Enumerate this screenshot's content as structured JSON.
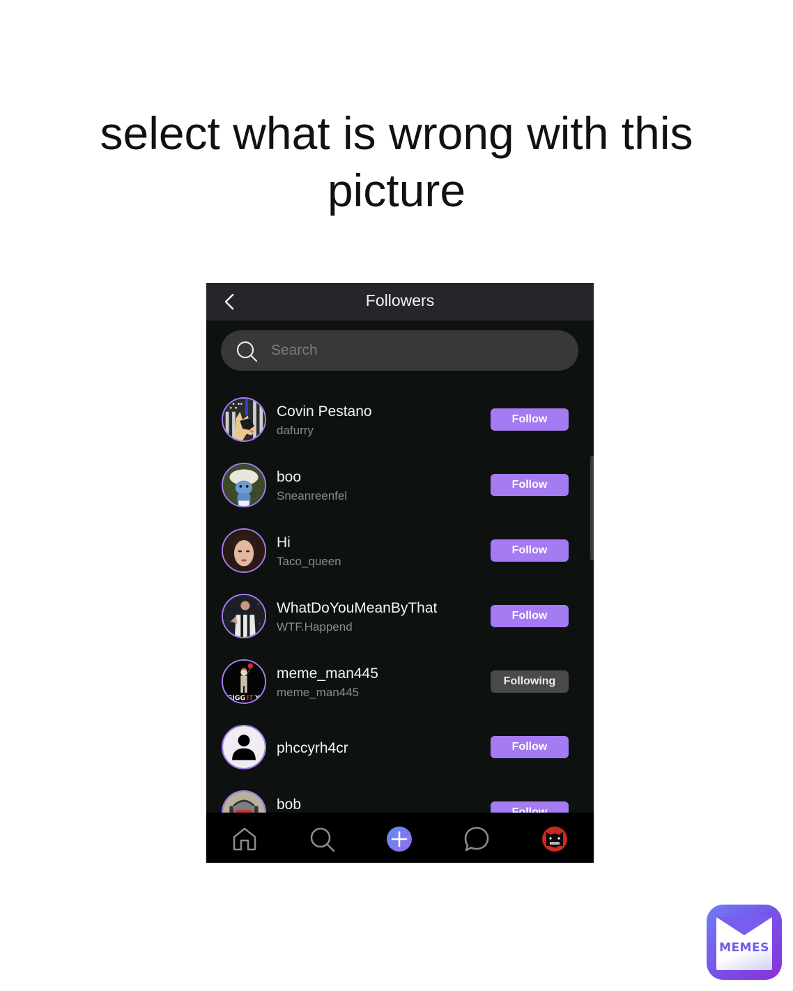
{
  "caption": "select what is wrong with this picture",
  "app": {
    "header": {
      "title": "Followers",
      "back_icon": "chevron-left-icon"
    },
    "search": {
      "placeholder": "Search",
      "value": "",
      "icon": "search-icon"
    },
    "followers": [
      {
        "name": "Covin Pestano",
        "handle": "dafurry",
        "button": "Follow",
        "following": false,
        "avatar": "german-shepherd-flag-avatar"
      },
      {
        "name": "boo",
        "handle": "Sneanreenfel",
        "button": "Follow",
        "following": false,
        "avatar": "smurf-cat-avatar"
      },
      {
        "name": "Hi",
        "handle": "Taco_queen",
        "button": "Follow",
        "following": false,
        "avatar": "woman-portrait-avatar"
      },
      {
        "name": "WhatDoYouMeanByThat",
        "handle": "WTF.Happend",
        "button": "Follow",
        "following": false,
        "avatar": "soccer-player-avatar"
      },
      {
        "name": "meme_man445",
        "handle": "meme_man445",
        "button": "Following",
        "following": true,
        "avatar": "giggity-clown-avatar"
      },
      {
        "name": "phccyrh4cr",
        "handle": "",
        "button": "Follow",
        "following": false,
        "avatar": "default-person-avatar"
      },
      {
        "name": "bob",
        "handle": "",
        "button": "Follow",
        "following": false,
        "avatar": "masked-soldier-avatar"
      }
    ],
    "tabbar": [
      {
        "name": "home",
        "icon": "home-icon"
      },
      {
        "name": "search",
        "icon": "search-icon"
      },
      {
        "name": "create",
        "icon": "plus-circle-icon"
      },
      {
        "name": "messages",
        "icon": "chat-bubble-icon"
      },
      {
        "name": "profile",
        "icon": "profile-avatar-icon"
      }
    ],
    "colors": {
      "accent": "#a47bf2",
      "following_button": "#4a4a4a",
      "background": "#0d1110",
      "header": "#27242a"
    }
  },
  "watermark": {
    "label": "MEMES",
    "icon": "memes-envelope-logo"
  }
}
